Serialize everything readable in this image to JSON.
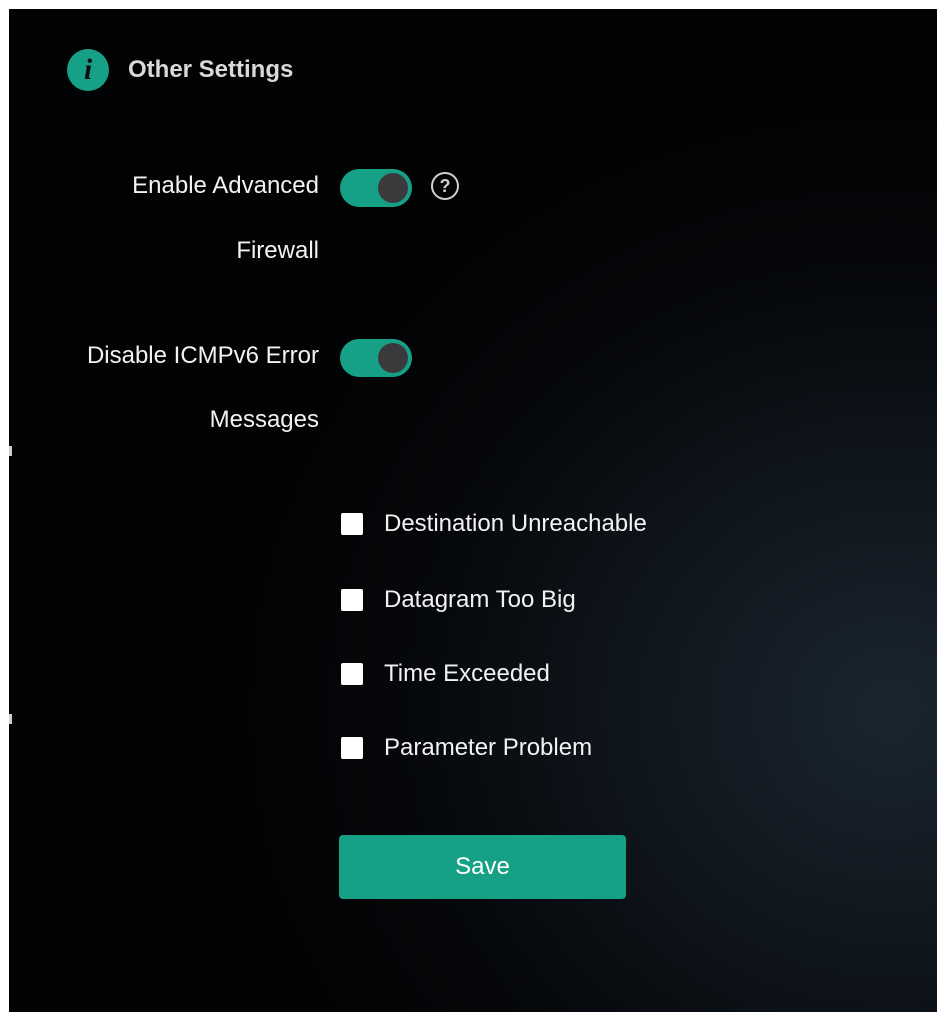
{
  "section": {
    "icon": "info-icon",
    "title": "Other Settings"
  },
  "settings": {
    "advanced_firewall": {
      "label_line1": "Enable Advanced",
      "label_line2": "Firewall",
      "enabled": true,
      "help_icon": "question-circle-icon",
      "help_glyph": "?"
    },
    "icmpv6_errors": {
      "label_line1": "Disable ICMPv6 Error",
      "label_line2": "Messages",
      "enabled": true
    }
  },
  "icmpv6_options": [
    {
      "label": "Destination Unreachable",
      "checked": false
    },
    {
      "label": "Datagram Too Big",
      "checked": false
    },
    {
      "label": "Time Exceeded",
      "checked": false
    },
    {
      "label": "Parameter Problem",
      "checked": false
    }
  ],
  "actions": {
    "save_label": "Save"
  },
  "colors": {
    "accent": "#16a085",
    "background": "#05070a",
    "text": "#f2f2f2"
  }
}
